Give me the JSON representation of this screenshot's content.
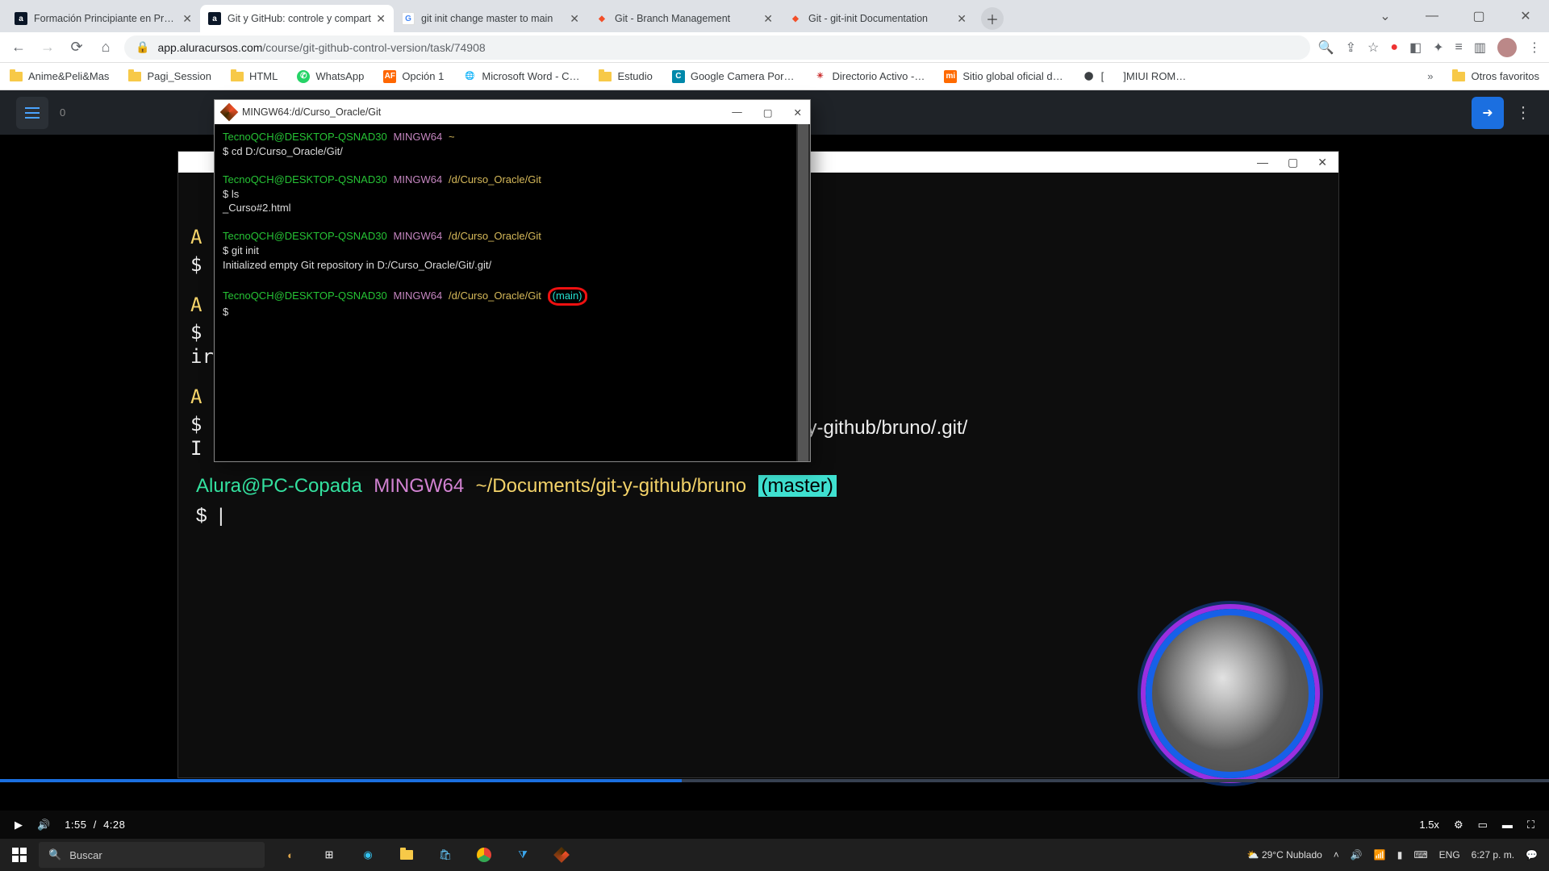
{
  "tabs": [
    {
      "title": "Formación Principiante en Progra",
      "favicon": "a",
      "fbg": "#0a1627",
      "fcol": "#fff"
    },
    {
      "title": "Git y GitHub: controle y compart",
      "favicon": "a",
      "fbg": "#0a1627",
      "fcol": "#fff",
      "active": true
    },
    {
      "title": "git init change master to main",
      "favicon": "G",
      "fbg": "#fff",
      "fcol": "#4285f4"
    },
    {
      "title": "Git - Branch Management",
      "favicon": "◆",
      "fbg": "#fff",
      "fcol": "#f34f29"
    },
    {
      "title": "Git - git-init Documentation",
      "favicon": "◆",
      "fbg": "#fff",
      "fcol": "#f34f29"
    }
  ],
  "url": {
    "host": "app.aluracursos.com",
    "path": "/course/git-github-control-version/task/74908"
  },
  "bookmarks": [
    {
      "label": "Anime&Peli&Mas",
      "ico": "folder"
    },
    {
      "label": "Pagi_Session",
      "ico": "folder"
    },
    {
      "label": "HTML",
      "ico": "folder"
    },
    {
      "label": "WhatsApp",
      "ico": "wa"
    },
    {
      "label": "Opción 1",
      "ico": "af"
    },
    {
      "label": "Microsoft Word - C…",
      "ico": "g"
    },
    {
      "label": "Estudio",
      "ico": "folder"
    },
    {
      "label": "Google Camera Por…",
      "ico": "c"
    },
    {
      "label": "Directorio Activo -…",
      "ico": "da"
    },
    {
      "label": "Sitio global oficial d…",
      "ico": "mi"
    },
    {
      "label": "[",
      "ico": "brk"
    },
    {
      "label": "]MIUI ROM…",
      "ico": "none"
    }
  ],
  "bookmarks_other": "Otros favoritos",
  "gitbash": {
    "title": "MINGW64:/d/Curso_Oracle/Git",
    "lines": {
      "u1": "TecnoQCH@DESKTOP-QSNAD30",
      "m1": "MINGW64",
      "home": "~",
      "cd": "$ cd D:/Curso_Oracle/Git/",
      "p": "/d/Curso_Oracle/Git",
      "ls": "$ ls",
      "lsout": "_Curso#2.html",
      "init": "$ git init",
      "initout": "Initialized empty Git repository in D:/Curso_Oracle/Git/.git/",
      "branch": "(main)",
      "prompt": "$"
    }
  },
  "peek": {
    "A": "A",
    "dollar": "$",
    "I": "I",
    "ir": "ir"
  },
  "bigterm": {
    "user": "Alura@PC-Copada",
    "mingw": "MINGW64",
    "path1": "~/Documents/git-y-github/bruno",
    "bruno": "bruno",
    "gitpath": "a/Documents/git-y-github/bruno/.git/",
    "branch": "(master)",
    "prompt": "$",
    "cursor": "|"
  },
  "video": {
    "current": "1:55",
    "total": "4:28",
    "speed": "1.5x"
  },
  "taskbar": {
    "search": "Buscar",
    "weather": "29°C  Nublado",
    "lang": "ENG",
    "time": "6:27 p. m."
  }
}
